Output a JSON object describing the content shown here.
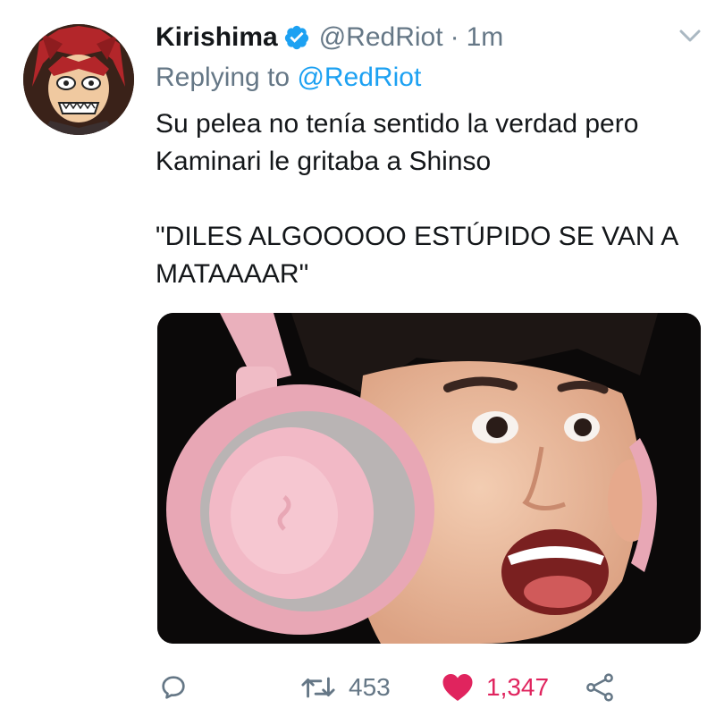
{
  "tweet": {
    "author": {
      "display_name": "Kirishima",
      "handle": "@RedRiot",
      "verified": true
    },
    "time_separator": "·",
    "time": "1m",
    "replying_prefix": "Replying to",
    "replying_handle": "@RedRiot",
    "text": {
      "line1": "Su pelea no tenía sentido la verdad pero",
      "line2": "Kaminari le gritaba a Shinso",
      "line3": "\"DILES ALGOOOOO ESTÚPIDO SE VAN A",
      "line4": "MATAAAAR\""
    },
    "actions": {
      "retweets": "453",
      "likes": "1,347",
      "liked": true
    }
  },
  "icons": {
    "verified": "verified-badge-icon",
    "more": "chevron-down-icon",
    "reply": "reply-icon",
    "retweet": "retweet-icon",
    "like": "heart-icon",
    "share": "share-icon"
  },
  "colors": {
    "accent": "#1da1f2",
    "like": "#e0245e",
    "secondary_text": "#657786",
    "primary_text": "#14171a"
  }
}
